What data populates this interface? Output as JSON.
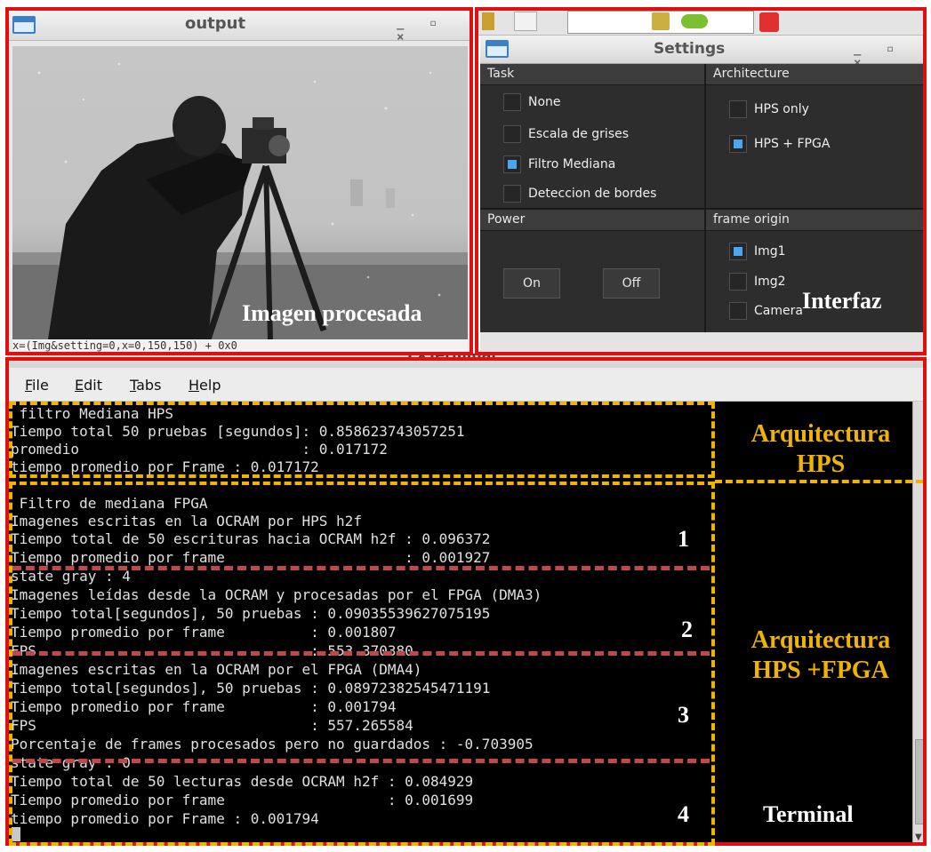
{
  "output_window": {
    "title": "output",
    "controls": "_ ▫ ×",
    "status_text": "x=(Img&setting=0,x=0,150,150) + 0x0"
  },
  "settings_window": {
    "title": "Settings",
    "controls": "_ ▫ ×",
    "task": {
      "heading": "Task",
      "options": [
        {
          "label": "None",
          "checked": false
        },
        {
          "label": "Escala de grises",
          "checked": false
        },
        {
          "label": "Filtro Mediana",
          "checked": true
        },
        {
          "label": "Deteccion de bordes",
          "checked": false
        }
      ]
    },
    "architecture": {
      "heading": "Architecture",
      "options": [
        {
          "label": "HPS only",
          "checked": false
        },
        {
          "label": "HPS + FPGA",
          "checked": true
        }
      ]
    },
    "power": {
      "heading": "Power",
      "on_label": "On",
      "off_label": "Off"
    },
    "frame_origin": {
      "heading": "frame origin",
      "options": [
        {
          "label": "Img1",
          "checked": true
        },
        {
          "label": "Img2",
          "checked": false
        },
        {
          "label": "Camera",
          "checked": false
        }
      ]
    }
  },
  "terminal": {
    "title": "LXTerminal",
    "menu": [
      "File",
      "Edit",
      "Tabs",
      "Help"
    ],
    "lines": [
      " filtro Mediana HPS",
      "Tiempo total 50 pruebas [segundos]: 0.858623743057251",
      "promedio                          : 0.017172",
      "tiempo promedio por Frame : 0.017172",
      "",
      " Filtro de mediana FPGA",
      "Imagenes escritas en la OCRAM por HPS h2f",
      "Tiempo total de 50 escrituras hacia OCRAM h2f : 0.096372",
      "Tiempo promedio por frame                     : 0.001927",
      "state gray : 4",
      "Imagenes leídas desde la OCRAM y procesadas por el FPGA (DMA3)",
      "Tiempo total[segundos], 50 pruebas : 0.09035539627075195",
      "Tiempo promedio por frame          : 0.001807",
      "FPS                                : 553.370380",
      "Imagenes escritas en la OCRAM por el FPGA (DMA4)",
      "Tiempo total[segundos], 50 pruebas : 0.08972382545471191",
      "Tiempo promedio por frame          : 0.001794",
      "FPS                                : 557.265584",
      "Porcentaje de frames procesados pero no guardados : -0.703905",
      "state gray : 0",
      "Tiempo total de 50 lecturas desde OCRAM h2f : 0.084929",
      "Tiempo promedio por frame                   : 0.001699",
      "tiempo promedio por Frame : 0.001794"
    ]
  },
  "annotations": {
    "imagen_procesada": "Imagen procesada",
    "interfaz": "Interfaz",
    "arq_hps_line1": "Arquitectura",
    "arq_hps_line2": "HPS",
    "arq_fpga_line1": "Arquitectura",
    "arq_fpga_line2": "HPS +FPGA",
    "terminal": "Terminal",
    "step_numbers": [
      "1",
      "2",
      "3",
      "4"
    ],
    "colors": {
      "red": "#e01010",
      "gold": "#f0b400",
      "separator": "#c04848"
    }
  }
}
